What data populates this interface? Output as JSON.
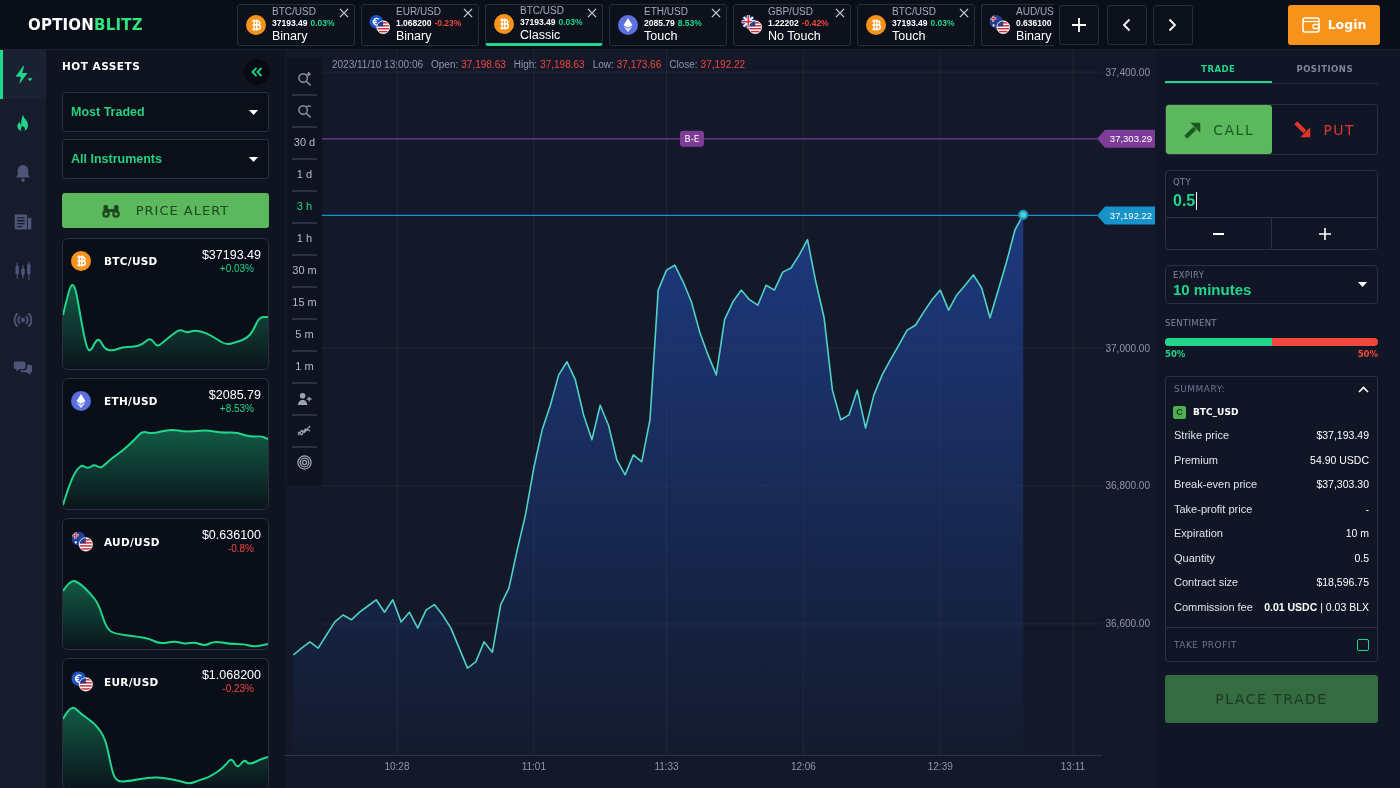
{
  "logo": {
    "text": "OPTION",
    "accent": "BLITZ"
  },
  "asset_tabs": [
    {
      "kind": "btc",
      "pair": "BTC/USD",
      "price": "37193.49",
      "change": "0.03%",
      "negative": false,
      "type": "Binary",
      "selected": false,
      "closable": true
    },
    {
      "kind": "eur",
      "pair": "EUR/USD",
      "price": "1.068200",
      "change": "-0.23%",
      "negative": true,
      "type": "Binary",
      "selected": false,
      "closable": true
    },
    {
      "kind": "btc",
      "pair": "BTC/USD",
      "price": "37193.49",
      "change": "0.03%",
      "negative": false,
      "type": "Classic",
      "selected": true,
      "closable": true
    },
    {
      "kind": "eth",
      "pair": "ETH/USD",
      "price": "2085.79",
      "change": "8.53%",
      "negative": false,
      "type": "Touch",
      "selected": false,
      "closable": true
    },
    {
      "kind": "gbp",
      "pair": "GBP/USD",
      "price": "1.22202",
      "change": "-0.42%",
      "negative": true,
      "type": "No Touch",
      "selected": false,
      "closable": true
    },
    {
      "kind": "btc",
      "pair": "BTC/USD",
      "price": "37193.49",
      "change": "0.03%",
      "negative": false,
      "type": "Touch",
      "selected": false,
      "closable": true
    },
    {
      "kind": "aud",
      "pair": "AUD/US",
      "price": "0.636100",
      "type": "Binary",
      "selected": false,
      "closable": false
    }
  ],
  "login_button": "Login",
  "sidebar_rail": [
    {
      "kind": "quick",
      "selected": true,
      "highlighted": true
    },
    {
      "kind": "hot",
      "selected": false,
      "highlighted": true
    },
    {
      "kind": "alerts",
      "selected": false,
      "highlighted": false
    },
    {
      "kind": "news",
      "selected": false,
      "highlighted": false
    },
    {
      "kind": "charts",
      "selected": false,
      "highlighted": false
    },
    {
      "kind": "signals",
      "selected": false,
      "highlighted": false
    },
    {
      "kind": "chat",
      "selected": false,
      "highlighted": false
    }
  ],
  "hot_assets": {
    "title": "HOT ASSETS",
    "sort_dropdown": "Most Traded",
    "filter_dropdown": "All Instruments",
    "price_alert_button": "PRICE ALERT",
    "assets": [
      {
        "kind": "btc",
        "pair": "BTC/USD",
        "price": "$37193.49",
        "change": "+0.03%",
        "negative": false
      },
      {
        "kind": "eth",
        "pair": "ETH/USD",
        "price": "$2085.79",
        "change": "+8.53%",
        "negative": false
      },
      {
        "kind": "aud",
        "pair": "AUD/USD",
        "price": "$0.636100",
        "change": "-0.8%",
        "negative": true
      },
      {
        "kind": "eur",
        "pair": "EUR/USD",
        "price": "$1.068200",
        "change": "-0.23%",
        "negative": true
      }
    ]
  },
  "chart": {
    "header": {
      "timestamp": "2023/11/10 13:00:06",
      "fields": [
        {
          "label": "Open:",
          "value": "37,198.63"
        },
        {
          "label": "High:",
          "value": "37,198.63"
        },
        {
          "label": "Low:",
          "value": "37,173.66"
        },
        {
          "label": "Close:",
          "value": "37,192.22"
        }
      ]
    },
    "timeframes": [
      {
        "label": "30 d",
        "selected": false
      },
      {
        "label": "1 d",
        "selected": false
      },
      {
        "label": "3 h",
        "selected": true
      },
      {
        "label": "1 h",
        "selected": false
      },
      {
        "label": "30 m",
        "selected": false
      },
      {
        "label": "15 m",
        "selected": false
      },
      {
        "label": "5 m",
        "selected": false
      },
      {
        "label": "1 m",
        "selected": false
      }
    ],
    "chart_data": [
      {
        "type": "area",
        "color": "#4fd1c5",
        "grid": true,
        "x": [
          "2023-11-10T10:03",
          "2023-11-10T10:05",
          "2023-11-10T10:07",
          "2023-11-10T10:09",
          "2023-11-10T10:11",
          "2023-11-10T10:13",
          "2023-11-10T10:15",
          "2023-11-10T10:17",
          "2023-11-10T10:19",
          "2023-11-10T10:21",
          "2023-11-10T10:23",
          "2023-11-10T10:25",
          "2023-11-10T10:27",
          "2023-11-10T10:29",
          "2023-11-10T10:31",
          "2023-11-10T10:33",
          "2023-11-10T10:35",
          "2023-11-10T10:37",
          "2023-11-10T10:39",
          "2023-11-10T10:41",
          "2023-11-10T10:43",
          "2023-11-10T10:45",
          "2023-11-10T10:47",
          "2023-11-10T10:49",
          "2023-11-10T10:51",
          "2023-11-10T10:53",
          "2023-11-10T10:55",
          "2023-11-10T10:57",
          "2023-11-10T10:59",
          "2023-11-10T11:01",
          "2023-11-10T11:03",
          "2023-11-10T11:05",
          "2023-11-10T11:07",
          "2023-11-10T11:09",
          "2023-11-10T11:11",
          "2023-11-10T11:13",
          "2023-11-10T11:15",
          "2023-11-10T11:17",
          "2023-11-10T11:19",
          "2023-11-10T11:21",
          "2023-11-10T11:23",
          "2023-11-10T11:25",
          "2023-11-10T11:27",
          "2023-11-10T11:29",
          "2023-11-10T11:31",
          "2023-11-10T11:33",
          "2023-11-10T11:35",
          "2023-11-10T11:37",
          "2023-11-10T11:39",
          "2023-11-10T11:41",
          "2023-11-10T11:43",
          "2023-11-10T11:45",
          "2023-11-10T11:47",
          "2023-11-10T11:49",
          "2023-11-10T11:51",
          "2023-11-10T11:53",
          "2023-11-10T11:55",
          "2023-11-10T11:57",
          "2023-11-10T11:59",
          "2023-11-10T12:01",
          "2023-11-10T12:03",
          "2023-11-10T12:05",
          "2023-11-10T12:07",
          "2023-11-10T12:09",
          "2023-11-10T12:11",
          "2023-11-10T12:13",
          "2023-11-10T12:15",
          "2023-11-10T12:17",
          "2023-11-10T12:19",
          "2023-11-10T12:21",
          "2023-11-10T12:23",
          "2023-11-10T12:25",
          "2023-11-10T12:27",
          "2023-11-10T12:29",
          "2023-11-10T12:31",
          "2023-11-10T12:33",
          "2023-11-10T12:35",
          "2023-11-10T12:37",
          "2023-11-10T12:39",
          "2023-11-10T12:41",
          "2023-11-10T12:43",
          "2023-11-10T12:45",
          "2023-11-10T12:47",
          "2023-11-10T12:49",
          "2023-11-10T12:51",
          "2023-11-10T12:53",
          "2023-11-10T12:55",
          "2023-11-10T12:57",
          "2023-11-10T12:59"
        ],
        "values": [
          36555,
          36565,
          36574,
          36565,
          36584,
          36603,
          36613,
          36606,
          36617,
          36626,
          36635,
          36617,
          36635,
          36603,
          36617,
          36594,
          36620,
          36628,
          36613,
          36594,
          36565,
          36536,
          36545,
          36574,
          36559,
          36628,
          36652,
          36707,
          36758,
          36826,
          36881,
          36917,
          36961,
          36980,
          36954,
          36903,
          36867,
          36917,
          36888,
          36838,
          36816,
          36845,
          36835,
          36896,
          37084,
          37113,
          37120,
          37096,
          37067,
          37023,
          36990,
          36961,
          37041,
          37067,
          37084,
          37070,
          37062,
          37091,
          37084,
          37110,
          37116,
          37135,
          37157,
          37096,
          37044,
          36939,
          36896,
          36903,
          36939,
          36884,
          36932,
          36961,
          36983,
          37004,
          37026,
          37033,
          37052,
          37070,
          37084,
          37055,
          37077,
          37091,
          37106,
          37087,
          37044,
          37084,
          37125,
          37171,
          37193
        ],
        "xlim": [
          "2023-11-10T10:01",
          "2023-11-10T13:18"
        ],
        "ylim": [
          36410,
          37432
        ],
        "xticks": [
          {
            "value": "2023-11-10T10:28",
            "label": "10:28"
          },
          {
            "value": "2023-11-10T11:01",
            "label": "11:01"
          },
          {
            "value": "2023-11-10T11:33",
            "label": "11:33"
          },
          {
            "value": "2023-11-10T12:06",
            "label": "12:06"
          },
          {
            "value": "2023-11-10T12:39",
            "label": "12:39"
          },
          {
            "value": "2023-11-10T13:11",
            "label": "13:11"
          }
        ],
        "yticks": [
          {
            "value": 36600,
            "label": "36,600.00"
          },
          {
            "value": 36800,
            "label": "36,800.00"
          },
          {
            "value": 37000,
            "label": "37,000.00"
          },
          {
            "value": 37400,
            "label": "37,400.00"
          }
        ],
        "ref_lines": [
          {
            "axis": "y",
            "value": 37303.29,
            "label": "B-E",
            "color": "#7d3c98"
          },
          {
            "axis": "y",
            "value": 37192.22,
            "color": "#1793c9"
          }
        ],
        "annotations": [
          "37,303.29",
          "37,192.22"
        ]
      }
    ]
  },
  "trade_panel": {
    "tabs": [
      {
        "label": "TRADE",
        "selected": true
      },
      {
        "label": "POSITIONS",
        "selected": false
      }
    ],
    "direction_options": [
      {
        "kind": "call",
        "label": "CALL",
        "selected": true
      },
      {
        "kind": "put",
        "label": "PUT",
        "selected": false
      }
    ],
    "quantity": {
      "label": "QTY",
      "value": "0.5"
    },
    "expiry": {
      "label": "EXPIRY",
      "value": "10 minutes"
    },
    "sentiment": {
      "label": "SENTIMENT",
      "level": 0.5,
      "call_share": "50%",
      "put_share": "50%"
    },
    "summary": {
      "title": "SUMMARY:",
      "expanded": true,
      "type_badge": "C",
      "asset": "BTC_USD",
      "rows": [
        {
          "label": "Strike price",
          "value": "$37,193.49"
        },
        {
          "label": "Premium",
          "value": "54.90 USDC"
        },
        {
          "label": "Break-even price",
          "value": "$37,303.30"
        },
        {
          "label": "Take-profit price",
          "value": "-"
        },
        {
          "label": "Expiration",
          "value": "10 m"
        },
        {
          "label": "Quantity",
          "value": "0.5"
        },
        {
          "label": "Contract size",
          "value": "$18,596.75"
        },
        {
          "label": "Commission fee",
          "value": "**0.01 USDC** | 0.03 BLX"
        }
      ],
      "take_profit": {
        "label": "TAKE PROFIT",
        "checked": false
      }
    },
    "place_trade_button": {
      "label": "PLACE TRADE",
      "disabled": true
    }
  }
}
